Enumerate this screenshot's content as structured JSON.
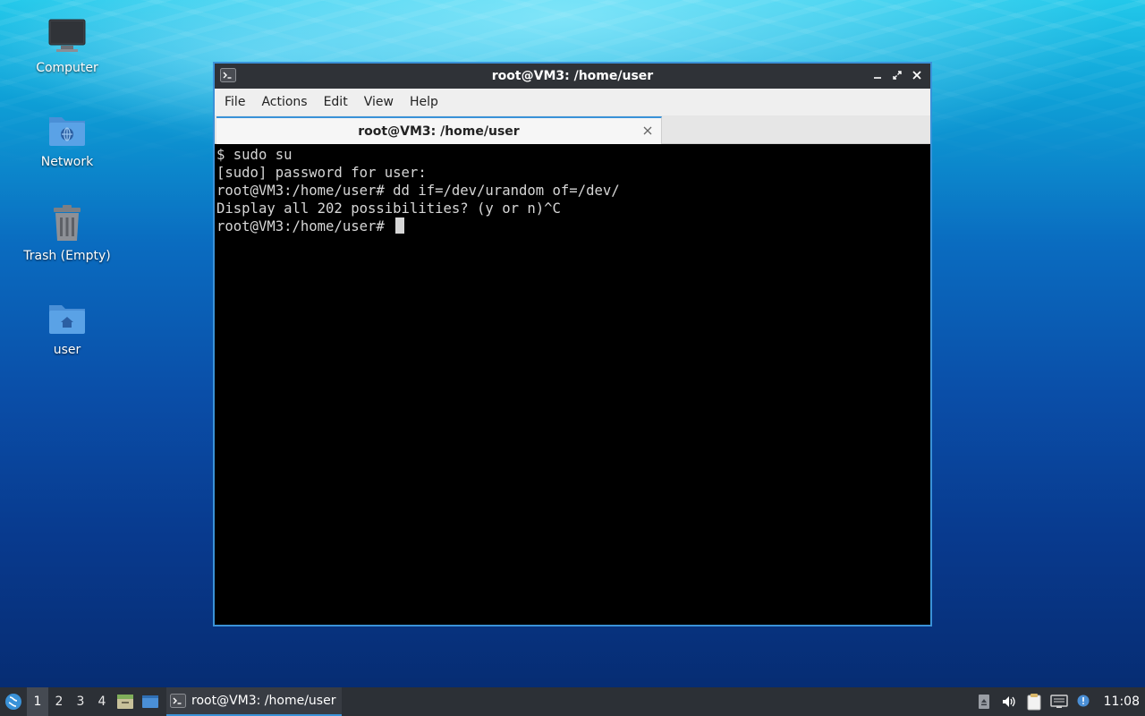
{
  "desktop": {
    "icons": [
      {
        "label": "Computer",
        "icon": "computer-icon"
      },
      {
        "label": "Network",
        "icon": "network-folder-icon"
      },
      {
        "label": "Trash (Empty)",
        "icon": "trash-icon"
      },
      {
        "label": "user",
        "icon": "home-folder-icon"
      }
    ]
  },
  "window": {
    "title": "root@VM3: /home/user",
    "menu": [
      "File",
      "Actions",
      "Edit",
      "View",
      "Help"
    ],
    "tab_label": "root@VM3: /home/user",
    "terminal_lines": [
      "$ sudo su",
      "[sudo] password for user:",
      "root@VM3:/home/user# dd if=/dev/urandom of=/dev/",
      "Display all 202 possibilities? (y or n)^C",
      "root@VM3:/home/user# "
    ]
  },
  "taskbar": {
    "workspaces": [
      "1",
      "2",
      "3",
      "4"
    ],
    "active_workspace": "1",
    "task_label": "root@VM3: /home/user",
    "clock": "11:08"
  },
  "colors": {
    "accent": "#3a92d8",
    "terminal_bg": "#000000",
    "terminal_fg": "#d6d6d6",
    "taskbar_bg": "#2c3036"
  }
}
